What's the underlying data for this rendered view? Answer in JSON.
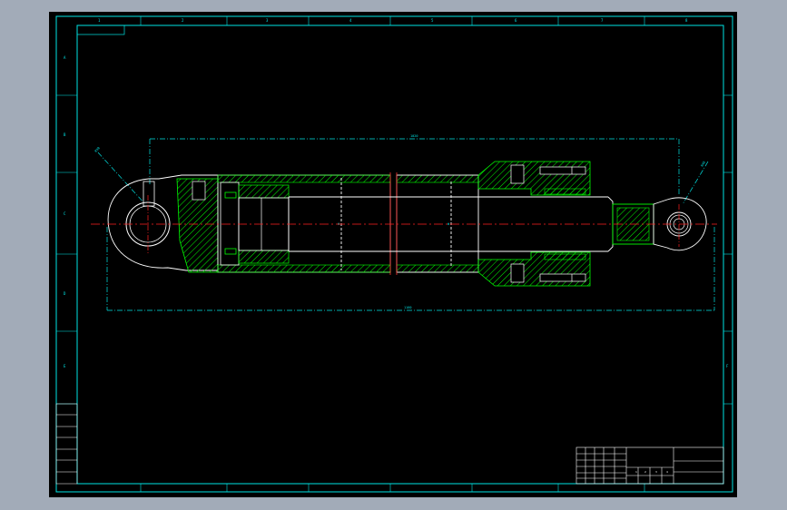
{
  "drawing": {
    "title_block": {
      "grid_label": "",
      "sheet_marks": [
        "1",
        "2",
        "3",
        "4"
      ]
    },
    "dimensions": {
      "top_span": "1020",
      "bottom_span": "1160",
      "left_radius": "R50",
      "right_radius": "R40",
      "bore_label": "Φ",
      "rod_label": "Φ"
    },
    "zone_top": [
      "1",
      "2",
      "3",
      "4",
      "5",
      "6",
      "7",
      "8"
    ],
    "zone_side": [
      "A",
      "B",
      "C",
      "D",
      "E",
      "F"
    ],
    "side_table": [
      "",
      "",
      "",
      "",
      "",
      "",
      ""
    ],
    "colors": {
      "frame": "#00e5e5",
      "part_outline": "#ffffff",
      "hatch": "#00ff00",
      "centerline": "#ff2020",
      "background": "#000000"
    }
  }
}
